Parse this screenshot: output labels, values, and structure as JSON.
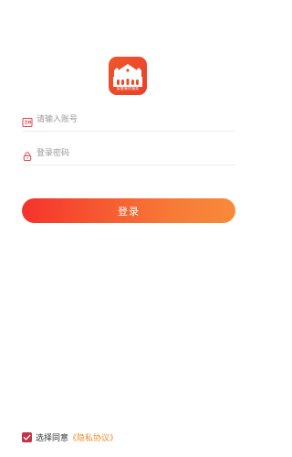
{
  "app": {
    "logo_caption": "智慧餐饮服务",
    "logo_icon": "school-building-icon",
    "brand_color": "#ef4b2b"
  },
  "login_form": {
    "account_placeholder": "请输入账号",
    "account_value": "",
    "account_icon": "id-card-icon",
    "password_placeholder": "登录密码",
    "password_value": "",
    "password_icon": "lock-icon",
    "submit_label": "登录",
    "submit_gradient": [
      "#f5332c",
      "#f98a3a"
    ]
  },
  "agreement": {
    "checked": true,
    "prefix": "选择同意",
    "link_label": "《隐私协议》",
    "checkbox_color": "#c2334a",
    "link_color": "#f08a24"
  }
}
